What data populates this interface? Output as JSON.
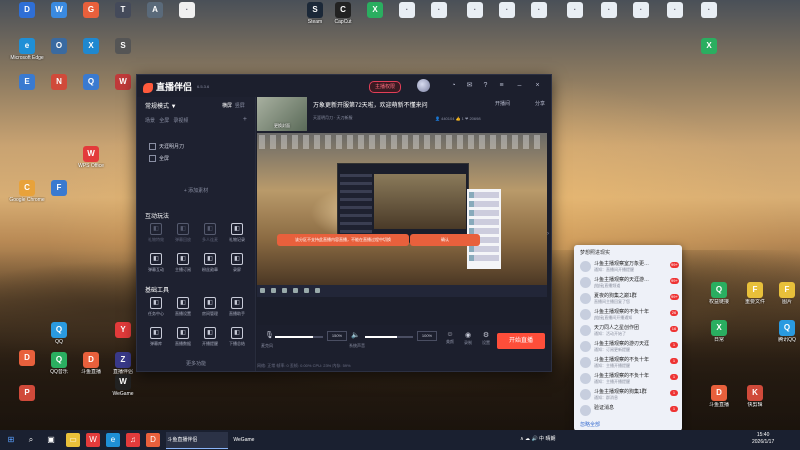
{
  "desktop": {
    "icons": [
      {
        "label": "",
        "color": "#2f6fd6",
        "glyph": "D"
      },
      {
        "label": "",
        "color": "#3a8ae0",
        "glyph": "W"
      },
      {
        "label": "",
        "color": "#e8603c",
        "glyph": "G"
      },
      {
        "label": "",
        "color": "#444a5a",
        "glyph": "T"
      },
      {
        "label": "",
        "color": "#5a6a7a",
        "glyph": "A"
      },
      {
        "label": "",
        "color": "#f0f0f0",
        "glyph": "·"
      },
      {
        "label": "Microsoft Edge",
        "color": "#1f8fd6",
        "glyph": "e"
      },
      {
        "label": "",
        "color": "#3a6aa0",
        "glyph": "O"
      },
      {
        "label": "",
        "color": "#1f88d0",
        "glyph": "X"
      },
      {
        "label": "",
        "color": "#555",
        "glyph": "S"
      },
      {
        "label": "",
        "color": "#3a7ad0",
        "glyph": "E"
      },
      {
        "label": "",
        "color": "#d04a3a",
        "glyph": "N"
      },
      {
        "label": "",
        "color": "#3a7ad0",
        "glyph": "Q"
      },
      {
        "label": "",
        "color": "#c03a3a",
        "glyph": "W"
      },
      {
        "label": "WPS Office",
        "color": "#e33b3b",
        "glyph": "W"
      },
      {
        "label": "Google Chrome",
        "color": "#e8a23a",
        "glyph": "C"
      },
      {
        "label": "",
        "color": "#3a7ad0",
        "glyph": "F"
      },
      {
        "label": "QQ",
        "color": "#2a9ae0",
        "glyph": "Q"
      },
      {
        "label": "",
        "color": "#e8603c",
        "glyph": "D"
      },
      {
        "label": "",
        "color": "#e33b3b",
        "glyph": "Y"
      },
      {
        "label": "QQ音乐",
        "color": "#2aae60",
        "glyph": "Q"
      },
      {
        "label": "斗鱼直播",
        "color": "#e8603c",
        "glyph": "D"
      },
      {
        "label": "直播伴侣",
        "color": "#3a3a8a",
        "glyph": "Z"
      },
      {
        "label": "WeGame",
        "color": "#222",
        "glyph": "W"
      },
      {
        "label": "",
        "color": "#d04a3a",
        "glyph": "P"
      },
      {
        "label": "Steam",
        "color": "#1b2838",
        "glyph": "S"
      },
      {
        "label": "CapCut",
        "color": "#222",
        "glyph": "C"
      },
      {
        "label": "",
        "color": "#2aae60",
        "glyph": "X"
      },
      {
        "label": "",
        "color": "#e8eef4",
        "glyph": "·"
      },
      {
        "label": "",
        "color": "#e8eef4",
        "glyph": "·"
      },
      {
        "label": "",
        "color": "#e8eef4",
        "glyph": "·"
      },
      {
        "label": "",
        "color": "#e8eef4",
        "glyph": "·"
      },
      {
        "label": "",
        "color": "#e8eef4",
        "glyph": "·"
      },
      {
        "label": "",
        "color": "#e8eef4",
        "glyph": "·"
      },
      {
        "label": "",
        "color": "#e8eef4",
        "glyph": "·"
      },
      {
        "label": "",
        "color": "#e8eef4",
        "glyph": "·"
      },
      {
        "label": "",
        "color": "#e8eef4",
        "glyph": "·"
      },
      {
        "label": "",
        "color": "#e8eef4",
        "glyph": "·"
      },
      {
        "label": "",
        "color": "#2aae60",
        "glyph": "X"
      },
      {
        "label": "权益链接",
        "color": "#2aae60",
        "glyph": "Q"
      },
      {
        "label": "重要文件",
        "color": "#e8c03a",
        "glyph": "F"
      },
      {
        "label": "图片",
        "color": "#e8c03a",
        "glyph": "F"
      },
      {
        "label": "日常",
        "color": "#2aae60",
        "glyph": "X"
      },
      {
        "label": "腾讯QQ",
        "color": "#2a9ae0",
        "glyph": "Q"
      },
      {
        "label": "斗鱼直播",
        "color": "#e8603c",
        "glyph": "D"
      },
      {
        "label": "快剪辑",
        "color": "#d04a3a",
        "glyph": "K"
      }
    ]
  },
  "app": {
    "name": "直播伴侣",
    "version": "6.5.3.6",
    "live_badge": "主播权限",
    "open_room": "开播间",
    "share": "分享",
    "sidebar": {
      "mode": "常规模式 ▼",
      "tab_landscape": "横屏",
      "tab_portrait": "竖屏",
      "scene_header": "场景",
      "scene_mode": "全屏",
      "scene_record": "录视频",
      "scenes": [
        "天涯明月刀",
        "全屏"
      ],
      "add_source": "+ 添加素材",
      "section_interact": "互动玩法",
      "interact_tools": [
        "礼物特效",
        "弹幕回放",
        "多人连麦",
        "礼物记录",
        "弹幕互动",
        "主播订阅",
        "粉丝勋章",
        "录屏"
      ],
      "section_basic": "基础工具",
      "basic_tools": [
        "任务中心",
        "直播设置",
        "房间管理",
        "直播助手",
        "弹幕库",
        "直播数据",
        "开播提醒",
        "下播总结"
      ],
      "more": "更多功能"
    },
    "room": {
      "thumb_label": "更换封面",
      "title": "万象更新开服第72天啦，欢迎萌新不懂来问",
      "category": "天涯明月刀 · 天刀新服",
      "stats": "👤 440104   👍 1   ❤ 20698"
    },
    "preview": {
      "toast": "该分区不支持此直播内容直播，不能在直播过程中切换",
      "toast2": "确认"
    },
    "controls": {
      "mic_label": "麦克风",
      "mic_value": "150%",
      "mic_level": 0.8,
      "sys_label": "系统声音",
      "sys_value": "100%",
      "sys_level": 0.66,
      "btn_beauty": "美颜",
      "btn_record": "录制",
      "btn_settings": "设置",
      "go_live": "开始直播",
      "status": "网络: 正常   帧率: 0   丢帧: 0.00%   CPU: 23%   内存: 59%"
    }
  },
  "chat": {
    "title": "梦想照进现实",
    "messages": [
      {
        "name": "斗鱼主播观察室万象更…",
        "sub": "通知：直播间开播提醒",
        "badge": "99+"
      },
      {
        "name": "斗鱼主播观察的天涯游…",
        "sub": "[链接]直播频道",
        "badge": "99+"
      },
      {
        "name": "夏夜的狗集之巅1群",
        "sub": "直播间主播回复了您",
        "badge": "99+"
      },
      {
        "name": "斗鱼主播观察的不负十年",
        "sub": "[链接]直播间开播通知",
        "badge": "26"
      },
      {
        "name": "天刀同人之星创作团",
        "sub": "通知：活动开始了",
        "badge": "16"
      },
      {
        "name": "斗鱼主播观察的游刃天涯",
        "sub": "通知：订阅更新提醒",
        "badge": "1"
      },
      {
        "name": "斗鱼主播观察的不负十年",
        "sub": "通知：主播开播提醒",
        "badge": "1"
      },
      {
        "name": "斗鱼主播观察的不负十年",
        "sub": "通知：主播开播提醒",
        "badge": "1"
      },
      {
        "name": "斗鱼主播观察的狗集1群",
        "sub": "通知：群消息",
        "badge": "1"
      },
      {
        "name": "验证消息",
        "sub": "",
        "badge": "1"
      }
    ],
    "footer": "忽略全部"
  },
  "taskbar": {
    "douyu_task": "斗鱼直播伴侣",
    "wegame_task": "WeGame",
    "tray": "∧ ☁ 🔊 中 晴朗",
    "time": "15:40",
    "date": "2026/1/17"
  }
}
